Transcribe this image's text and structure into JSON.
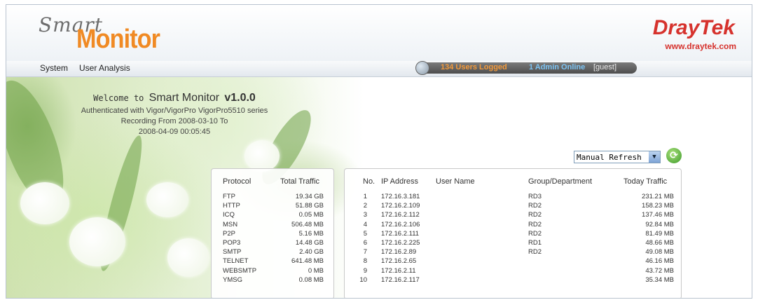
{
  "header": {
    "logo_smart": "Smart",
    "logo_monitor": "Monitor",
    "brand": "DrayTek",
    "brand_url": "www.draytek.com"
  },
  "menu": [
    "System",
    "User Analysis"
  ],
  "status": {
    "users": "134 Users Logged",
    "admin": "1 Admin Online",
    "user": "[guest]"
  },
  "welcome": {
    "prefix": "Welcome to ",
    "title": "Smart Monitor",
    "version": "v1.0.0",
    "auth": "Authenticated with Vigor/VigorPro VigorPro5510 series",
    "recording": "Recording From 2008-03-10 To",
    "until": "2008-04-09 00:05:45"
  },
  "refresh": {
    "selected": "Manual Refresh"
  },
  "protocol_table": {
    "headers": [
      "Protocol",
      "Total Traffic"
    ],
    "rows": [
      [
        "FTP",
        "19.34 GB"
      ],
      [
        "HTTP",
        "51.88 GB"
      ],
      [
        "ICQ",
        "0.05 MB"
      ],
      [
        "MSN",
        "506.48 MB"
      ],
      [
        "P2P",
        "5.16 MB"
      ],
      [
        "POP3",
        "14.48 GB"
      ],
      [
        "SMTP",
        "2.40 GB"
      ],
      [
        "TELNET",
        "641.48 MB"
      ],
      [
        "WEBSMTP",
        "0 MB"
      ],
      [
        "YMSG",
        "0.08 MB"
      ]
    ]
  },
  "user_table": {
    "headers": [
      "No.",
      "IP Address",
      "User Name",
      "Group/Department",
      "Today Traffic"
    ],
    "rows": [
      [
        "1",
        "172.16.3.181",
        "",
        "RD3",
        "231.21 MB"
      ],
      [
        "2",
        "172.16.2.109",
        "",
        "RD2",
        "158.23 MB"
      ],
      [
        "3",
        "172.16.2.112",
        "",
        "RD2",
        "137.46 MB"
      ],
      [
        "4",
        "172.16.2.106",
        "",
        "RD2",
        "92.84 MB"
      ],
      [
        "5",
        "172.16.2.111",
        "",
        "RD2",
        "81.49 MB"
      ],
      [
        "6",
        "172.16.2.225",
        "",
        "RD1",
        "48.66 MB"
      ],
      [
        "7",
        "172.16.2.89",
        "",
        "RD2",
        "49.08 MB"
      ],
      [
        "8",
        "172.16.2.65",
        "",
        "",
        "46.16 MB"
      ],
      [
        "9",
        "172.16.2.11",
        "",
        "",
        "43.72 MB"
      ],
      [
        "10",
        "172.16.2.117",
        "",
        "",
        "35.34 MB"
      ]
    ]
  },
  "colors": {
    "accent": "#f08a24",
    "brand": "#d6322d",
    "admin": "#7cc4f4"
  }
}
